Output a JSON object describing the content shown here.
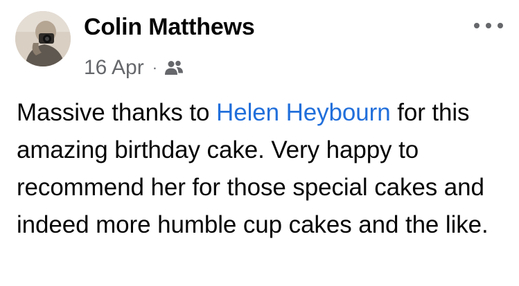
{
  "post": {
    "author": "Colin Matthews",
    "date": "16 Apr",
    "separator": "·",
    "audience_icon": "friends-icon",
    "more_icon": "more-horizontal-icon",
    "text_before": "Massive thanks to ",
    "mention": "Helen Heybourn",
    "text_after": " for this amazing birthday cake. Very happy to recommend her for those special cakes and indeed more humble cup cakes and the like.",
    "colors": {
      "text": "#050505",
      "secondary": "#65676b",
      "mention": "#216fdb"
    }
  }
}
